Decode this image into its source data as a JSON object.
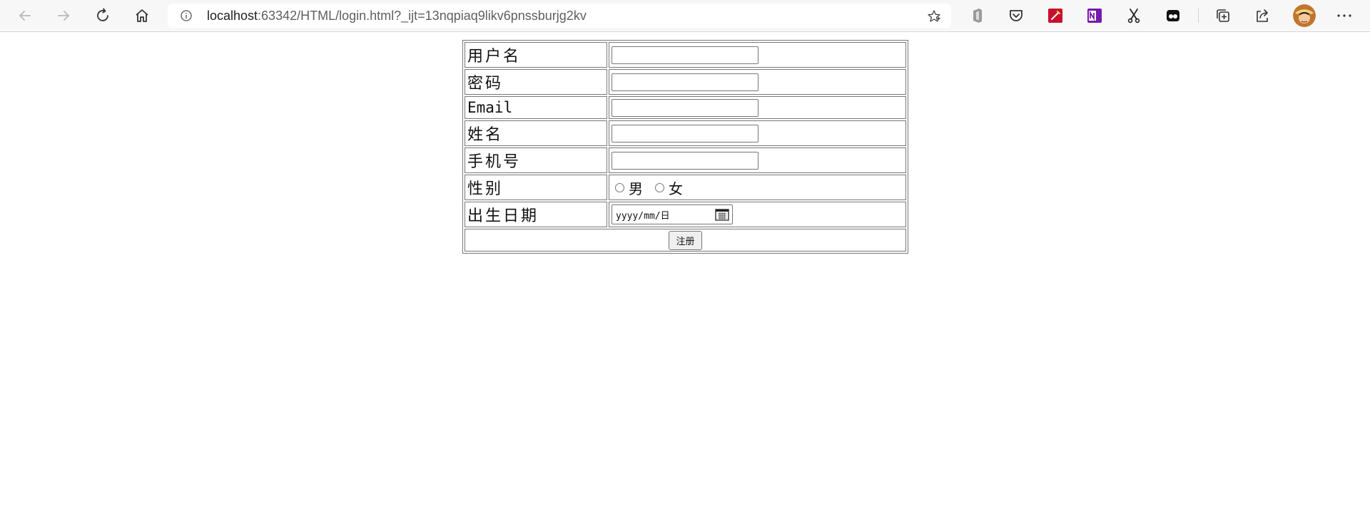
{
  "browser": {
    "url_host": "localhost",
    "url_rest": ":63342/HTML/login.html?_ijt=13nqpiaq9likv6pnssburjg2kv",
    "icons": {
      "back": "arrow-left-icon",
      "forward": "arrow-right-icon",
      "refresh": "refresh-icon",
      "home": "home-icon",
      "info": "info-icon",
      "favorite": "star-icon",
      "extensions": [
        "office-icon",
        "pocket-icon",
        "pdf-tool-icon",
        "onenote-icon",
        "scissors-icon",
        "game-icon"
      ],
      "collections": "collections-icon",
      "share": "share-icon",
      "profile": "avatar",
      "menu": "more-icon"
    }
  },
  "form": {
    "rows": [
      {
        "label": "用户名",
        "type": "text",
        "value": ""
      },
      {
        "label": "密码",
        "type": "password",
        "value": ""
      },
      {
        "label": "Email",
        "type": "text",
        "value": ""
      },
      {
        "label": "姓名",
        "type": "text",
        "value": ""
      },
      {
        "label": "手机号",
        "type": "text",
        "value": ""
      }
    ],
    "gender": {
      "label": "性别",
      "options": [
        "男",
        "女"
      ],
      "selected": null
    },
    "birthdate": {
      "label": "出生日期",
      "placeholder": "yyyy/mm/日"
    },
    "submit_label": "注册"
  },
  "colors": {
    "chrome_bg": "#f7f7f7",
    "border": "#777777",
    "button_bg": "#efefef"
  }
}
